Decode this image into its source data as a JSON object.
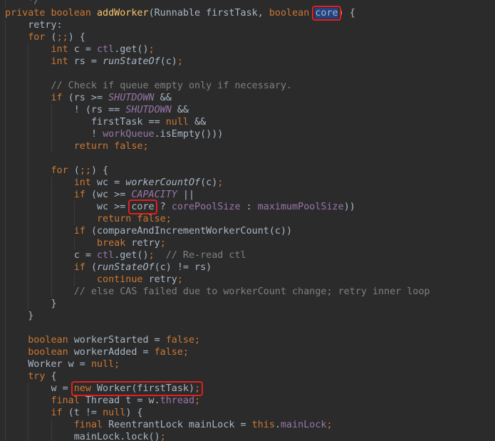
{
  "editor": {
    "language": "Java",
    "theme_colors": {
      "background": "#2b2b2b",
      "text": "#a9b7c6",
      "keyword": "#cc7832",
      "method_declaration": "#ffc66d",
      "constant_field": "#9876aa",
      "comment": "#808080",
      "selection": "#214283",
      "highlight_box": "#e02020"
    },
    "lines": [
      {
        "indent": 1,
        "tokens": [
          {
            "t": "*/",
            "c": "cmt"
          }
        ]
      },
      {
        "indent": 0,
        "tokens": [
          {
            "t": "private boolean ",
            "c": "kw"
          },
          {
            "t": "addWorker",
            "c": "fn"
          },
          {
            "t": "(Runnable firstTask, "
          },
          {
            "t": "boolean ",
            "c": "kw"
          },
          {
            "t": "core",
            "c": "sel",
            "box": "core-param"
          },
          {
            "t": ") {"
          }
        ]
      },
      {
        "indent": 1,
        "tokens": [
          {
            "t": "retry:"
          }
        ]
      },
      {
        "indent": 1,
        "tokens": [
          {
            "t": "for ",
            "c": "kw"
          },
          {
            "t": "("
          },
          {
            "t": ";;",
            "c": "kw"
          },
          {
            "t": ") {"
          }
        ]
      },
      {
        "indent": 2,
        "tokens": [
          {
            "t": "int ",
            "c": "kw"
          },
          {
            "t": "c = "
          },
          {
            "t": "ctl",
            "c": "fld"
          },
          {
            "t": ".get()"
          },
          {
            "t": ";",
            "c": "kw"
          }
        ]
      },
      {
        "indent": 2,
        "tokens": [
          {
            "t": "int ",
            "c": "kw"
          },
          {
            "t": "rs = "
          },
          {
            "t": "runStateOf",
            "c": "ital"
          },
          {
            "t": "(c)"
          },
          {
            "t": ";",
            "c": "kw"
          }
        ]
      },
      {
        "indent": 2,
        "tokens": []
      },
      {
        "indent": 2,
        "tokens": [
          {
            "t": "// Check if queue empty only if necessary.",
            "c": "cmt"
          }
        ]
      },
      {
        "indent": 2,
        "tokens": [
          {
            "t": "if ",
            "c": "kw"
          },
          {
            "t": "(rs >= "
          },
          {
            "t": "SHUTDOWN",
            "c": "cst"
          },
          {
            "t": " &&"
          }
        ]
      },
      {
        "indent": 3,
        "tokens": [
          {
            "t": "! (rs == "
          },
          {
            "t": "SHUTDOWN",
            "c": "cst"
          },
          {
            "t": " &&"
          }
        ]
      },
      {
        "indent": 3,
        "extra": 3,
        "tokens": [
          {
            "t": "firstTask == "
          },
          {
            "t": "null ",
            "c": "kw"
          },
          {
            "t": "&&"
          }
        ]
      },
      {
        "indent": 3,
        "extra": 3,
        "tokens": [
          {
            "t": "! "
          },
          {
            "t": "workQueue",
            "c": "fld"
          },
          {
            "t": ".isEmpty()))"
          }
        ]
      },
      {
        "indent": 3,
        "tokens": [
          {
            "t": "return false;",
            "c": "kw"
          }
        ]
      },
      {
        "indent": 2,
        "tokens": []
      },
      {
        "indent": 2,
        "tokens": [
          {
            "t": "for ",
            "c": "kw"
          },
          {
            "t": "("
          },
          {
            "t": ";;",
            "c": "kw"
          },
          {
            "t": ") {"
          }
        ]
      },
      {
        "indent": 3,
        "tokens": [
          {
            "t": "int ",
            "c": "kw"
          },
          {
            "t": "wc = "
          },
          {
            "t": "workerCountOf",
            "c": "ital"
          },
          {
            "t": "(c)"
          },
          {
            "t": ";",
            "c": "kw"
          }
        ]
      },
      {
        "indent": 3,
        "tokens": [
          {
            "t": "if ",
            "c": "kw"
          },
          {
            "t": "(wc >= "
          },
          {
            "t": "CAPACITY",
            "c": "cst"
          },
          {
            "t": " ||"
          }
        ]
      },
      {
        "indent": 4,
        "tokens": [
          {
            "t": "wc >= "
          },
          {
            "t": "core",
            "box": "core-ternary"
          },
          {
            "t": " ? "
          },
          {
            "t": "corePoolSize",
            "c": "fld"
          },
          {
            "t": " : "
          },
          {
            "t": "maximumPoolSize",
            "c": "fld"
          },
          {
            "t": "))"
          }
        ]
      },
      {
        "indent": 4,
        "tokens": [
          {
            "t": "return false;",
            "c": "kw"
          }
        ]
      },
      {
        "indent": 3,
        "tokens": [
          {
            "t": "if ",
            "c": "kw"
          },
          {
            "t": "(compareAndIncrementWorkerCount(c))"
          }
        ]
      },
      {
        "indent": 4,
        "tokens": [
          {
            "t": "break ",
            "c": "kw"
          },
          {
            "t": "retry"
          },
          {
            "t": ";",
            "c": "kw"
          }
        ]
      },
      {
        "indent": 3,
        "tokens": [
          {
            "t": "c = "
          },
          {
            "t": "ctl",
            "c": "fld"
          },
          {
            "t": ".get()"
          },
          {
            "t": ";  ",
            "c": "kw"
          },
          {
            "t": "// Re-read ctl",
            "c": "cmt"
          }
        ]
      },
      {
        "indent": 3,
        "tokens": [
          {
            "t": "if ",
            "c": "kw"
          },
          {
            "t": "("
          },
          {
            "t": "runStateOf",
            "c": "ital"
          },
          {
            "t": "(c) != rs)"
          }
        ]
      },
      {
        "indent": 4,
        "tokens": [
          {
            "t": "continue ",
            "c": "kw"
          },
          {
            "t": "retry"
          },
          {
            "t": ";",
            "c": "kw"
          }
        ]
      },
      {
        "indent": 3,
        "tokens": [
          {
            "t": "// else CAS failed due to workerCount change; retry inner loop",
            "c": "cmt"
          }
        ]
      },
      {
        "indent": 2,
        "tokens": [
          {
            "t": "}"
          }
        ]
      },
      {
        "indent": 1,
        "tokens": [
          {
            "t": "}"
          }
        ]
      },
      {
        "indent": 1,
        "tokens": []
      },
      {
        "indent": 1,
        "tokens": [
          {
            "t": "boolean ",
            "c": "kw"
          },
          {
            "t": "workerStarted = "
          },
          {
            "t": "false;",
            "c": "kw"
          }
        ]
      },
      {
        "indent": 1,
        "tokens": [
          {
            "t": "boolean ",
            "c": "kw"
          },
          {
            "t": "workerAdded = "
          },
          {
            "t": "false;",
            "c": "kw"
          }
        ]
      },
      {
        "indent": 1,
        "tokens": [
          {
            "t": "Worker w = "
          },
          {
            "t": "null;",
            "c": "kw"
          }
        ]
      },
      {
        "indent": 1,
        "tokens": [
          {
            "t": "try ",
            "c": "kw"
          },
          {
            "t": "{"
          }
        ]
      },
      {
        "indent": 2,
        "tokens": [
          {
            "t": "w = "
          },
          {
            "t": "new ",
            "c": "kw",
            "box": "new-worker"
          },
          {
            "t": "Worker(firstTask)"
          },
          {
            "t": ";",
            "c": "kw"
          }
        ]
      },
      {
        "indent": 2,
        "tokens": [
          {
            "t": "final ",
            "c": "kw"
          },
          {
            "t": "Thread t = w."
          },
          {
            "t": "thread",
            "c": "fld"
          },
          {
            "t": ";",
            "c": "kw"
          }
        ]
      },
      {
        "indent": 2,
        "tokens": [
          {
            "t": "if ",
            "c": "kw"
          },
          {
            "t": "(t != "
          },
          {
            "t": "null",
            "c": "kw"
          },
          {
            "t": ") {"
          }
        ]
      },
      {
        "indent": 3,
        "tokens": [
          {
            "t": "final ",
            "c": "kw"
          },
          {
            "t": "ReentrantLock mainLock = "
          },
          {
            "t": "this",
            "c": "kw"
          },
          {
            "t": "."
          },
          {
            "t": "mainLock",
            "c": "fld"
          },
          {
            "t": ";",
            "c": "kw"
          }
        ]
      },
      {
        "indent": 3,
        "tokens": [
          {
            "t": "mainLock.lock()"
          },
          {
            "t": ";",
            "c": "kw"
          }
        ]
      }
    ]
  }
}
